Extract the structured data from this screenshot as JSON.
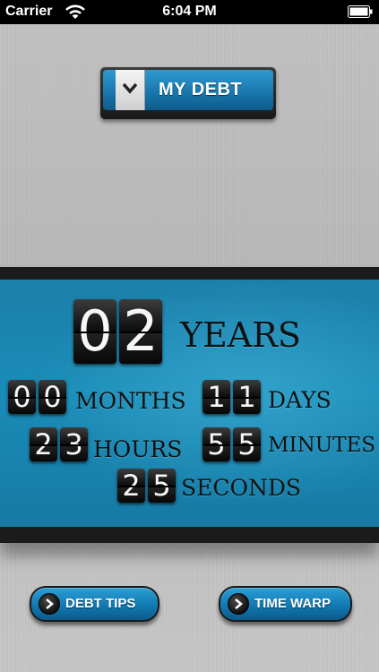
{
  "status_bar": {
    "carrier": "Carrier",
    "time": "6:04 PM"
  },
  "header": {
    "selector_label": "MY DEBT",
    "selector_icon": "chevron-down-icon"
  },
  "countdown": {
    "years": {
      "digits": [
        "0",
        "2"
      ],
      "label": "YEARS"
    },
    "months": {
      "digits": [
        "0",
        "0"
      ],
      "label": "MONTHS"
    },
    "days": {
      "digits": [
        "1",
        "1"
      ],
      "label": "DAYS"
    },
    "hours": {
      "digits": [
        "2",
        "3"
      ],
      "label": "HOURS"
    },
    "minutes": {
      "digits": [
        "5",
        "5"
      ],
      "label": "MINUTES"
    },
    "seconds": {
      "digits": [
        "2",
        "5"
      ],
      "label": "SECONDS"
    },
    "panel_color": "#1a8cb8"
  },
  "buttons": {
    "debt_tips": "DEBT TIPS",
    "time_warp": "TIME WARP",
    "icon": "chevron-right-icon"
  }
}
